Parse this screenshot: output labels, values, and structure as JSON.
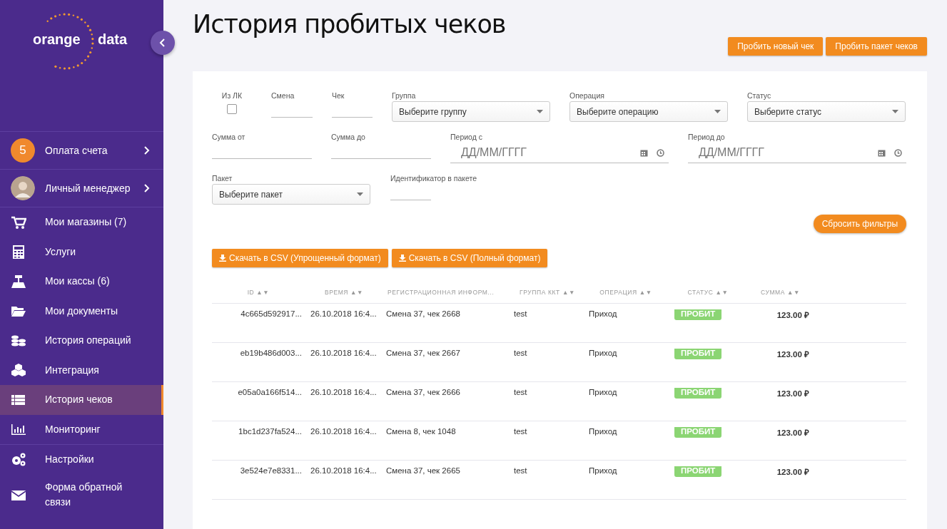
{
  "logo": {
    "left": "orange",
    "right": "data"
  },
  "sidebar": {
    "account": [
      {
        "badge": "5",
        "label": "Оплата счета",
        "kind": "badge"
      },
      {
        "label": "Личный менеджер",
        "kind": "avatar"
      }
    ],
    "items": [
      {
        "label": "Мои магазины (7)",
        "selected": false
      },
      {
        "label": "Услуги",
        "selected": false
      },
      {
        "label": "Мои кассы (6)",
        "selected": false
      },
      {
        "label": "Мои документы",
        "selected": false
      },
      {
        "label": "История операций",
        "selected": false
      },
      {
        "label": "Интеграция",
        "selected": false
      },
      {
        "label": "История чеков",
        "selected": true
      },
      {
        "label": "Мониторинг",
        "selected": false
      },
      {
        "label": "Настройки",
        "selected": false
      },
      {
        "label": "Форма обратной связи",
        "selected": false
      }
    ]
  },
  "page": {
    "title": "История пробитых чеков",
    "actions": [
      "Пробить новый чек",
      "Пробить пакет чеков"
    ]
  },
  "filters": [
    [
      {
        "kind": "checkbox",
        "label": "Из ЛК",
        "checked": false
      },
      {
        "kind": "text",
        "label": "Смена"
      },
      {
        "kind": "text",
        "label": "Чек"
      },
      {
        "kind": "select",
        "label": "Группа",
        "placeholder": "Выберите группу"
      },
      {
        "kind": "select",
        "label": "Операция",
        "placeholder": "Выберите операцию"
      },
      {
        "kind": "select",
        "label": "Статус",
        "placeholder": "Выберите статус"
      }
    ],
    [
      {
        "kind": "text",
        "label": "Сумма от"
      },
      {
        "kind": "text",
        "label": "Сумма до"
      },
      {
        "kind": "date",
        "label": "Период с",
        "placeholder": "ДД/ММ/ГГГГ"
      },
      {
        "kind": "date",
        "label": "Период до",
        "placeholder": "ДД/ММ/ГГГГ"
      }
    ],
    [
      {
        "kind": "select",
        "label": "Пакет",
        "placeholder": "Выберите пакет"
      },
      {
        "kind": "text",
        "label": "Идентификатор в пакете"
      }
    ]
  ],
  "reset_button": "Сбросить фильтры",
  "export_buttons": [
    "Скачать в CSV (Упрощенный формат)",
    "Скачать в CSV (Полный формат)"
  ],
  "table": {
    "columns": [
      {
        "label": "ID",
        "sort": "▲▼"
      },
      {
        "label": "ВРЕМЯ",
        "sort": "▲▼"
      },
      {
        "label": "РЕГИСТРАЦИОННАЯ ИНФОРМ..."
      },
      {
        "label": "ГРУППА ККТ",
        "sort": "▲▼"
      },
      {
        "label": "ОПЕРАЦИЯ",
        "sort": "▲▼"
      },
      {
        "label": "СТАТУС",
        "sort": "▲▼"
      },
      {
        "label": "СУММА",
        "sort": "▲▼"
      }
    ],
    "rows": [
      [
        "4c665d592917...",
        "26.10.2018 16:4...",
        "Смена 37, чек 2668",
        "test",
        "Приход",
        "ПРОБИТ",
        "123.00 ₽"
      ],
      [
        "eb19b486d003...",
        "26.10.2018 16:4...",
        "Смена 37, чек 2667",
        "test",
        "Приход",
        "ПРОБИТ",
        "123.00 ₽"
      ],
      [
        "e05a0a166f514...",
        "26.10.2018 16:4...",
        "Смена 37, чек 2666",
        "test",
        "Приход",
        "ПРОБИТ",
        "123.00 ₽"
      ],
      [
        "1bc1d237fa524...",
        "26.10.2018 16:4...",
        "Смена 8, чек 1048",
        "test",
        "Приход",
        "ПРОБИТ",
        "123.00 ₽"
      ],
      [
        "3e524e7e8331...",
        "26.10.2018 16:4...",
        "Смена 37, чек 2665",
        "test",
        "Приход",
        "ПРОБИТ",
        "123.00 ₽"
      ]
    ]
  }
}
